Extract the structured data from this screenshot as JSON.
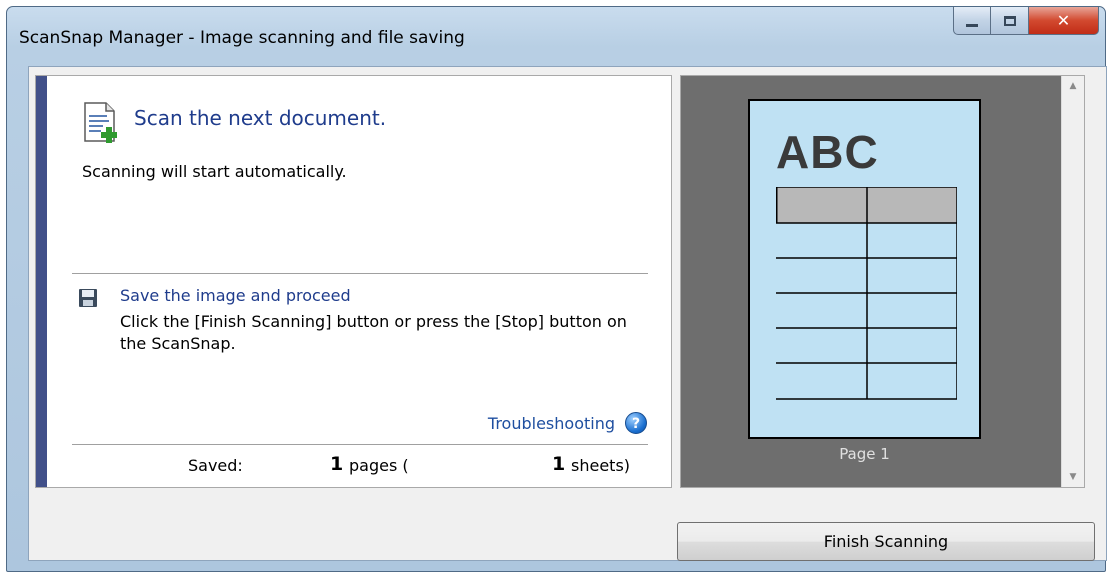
{
  "window": {
    "title": "ScanSnap Manager - Image scanning and file saving",
    "controls": {
      "minimize": "minimize-icon",
      "maximize": "maximize-icon",
      "close": "close-icon"
    }
  },
  "status": {
    "heading": "Scan the next document.",
    "subtext": "Scanning will start automatically."
  },
  "save": {
    "link_label": "Save the image and proceed",
    "instruction": "Click the [Finish Scanning] button or press the [Stop] button on the ScanSnap."
  },
  "troubleshooting": {
    "label": "Troubleshooting",
    "icon": "help-icon"
  },
  "stats": {
    "saved_label": "Saved:",
    "pages_count": "1",
    "pages_label": "pages (",
    "sheets_count": "1",
    "sheets_label": "sheets)"
  },
  "preview": {
    "thumbnail_text": "ABC",
    "page_label": "Page 1",
    "table_header_fill": "#b8b8b8",
    "page_fill": "#bfe1f3"
  },
  "footer": {
    "finish_button": "Finish Scanning"
  },
  "colors": {
    "accent_bar": "#415089",
    "link": "#1f3c8c",
    "preview_bg": "#6e6e6e"
  }
}
